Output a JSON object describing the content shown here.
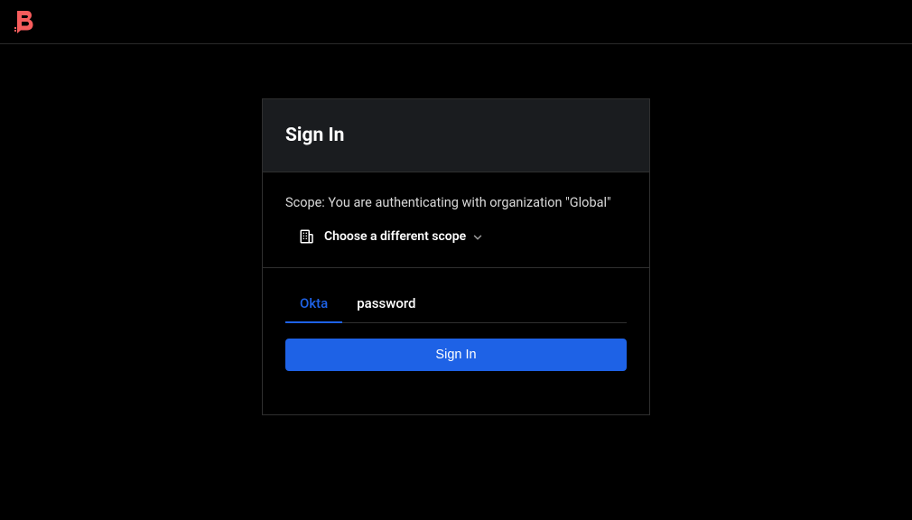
{
  "header": {
    "title": "Sign In"
  },
  "scope": {
    "message": "Scope: You are authenticating with organization \"Global\"",
    "change_label": "Choose a different scope"
  },
  "tabs": [
    {
      "label": "Okta",
      "active": true
    },
    {
      "label": "password",
      "active": false
    }
  ],
  "actions": {
    "signin": "Sign In"
  },
  "colors": {
    "accent": "#1e62e6",
    "logo": "#f75c5c"
  }
}
